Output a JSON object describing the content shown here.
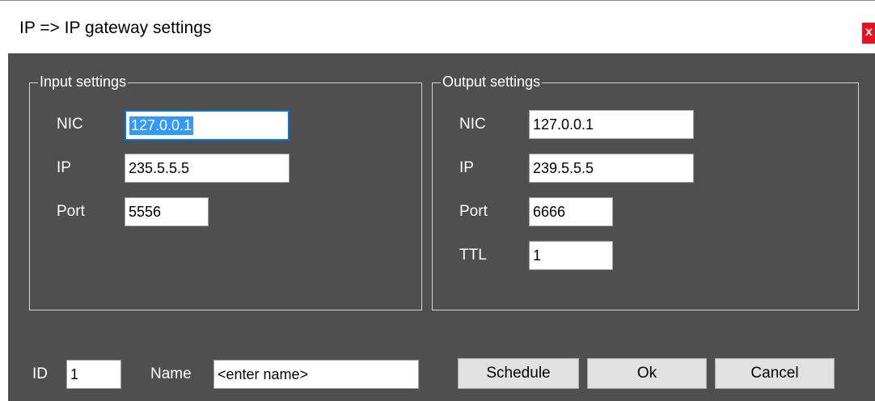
{
  "window": {
    "title": "IP => IP gateway settings",
    "close_label": "x"
  },
  "input_settings": {
    "legend": "Input settings",
    "nic_label": "NIC",
    "nic_value": "127.0.0.1",
    "ip_label": "IP",
    "ip_value": "235.5.5.5",
    "port_label": "Port",
    "port_value": "5556"
  },
  "output_settings": {
    "legend": "Output settings",
    "nic_label": "NIC",
    "nic_value": "127.0.0.1",
    "ip_label": "IP",
    "ip_value": "239.5.5.5",
    "port_label": "Port",
    "port_value": "6666",
    "ttl_label": "TTL",
    "ttl_value": "1"
  },
  "footer": {
    "id_label": "ID",
    "id_value": "1",
    "name_label": "Name",
    "name_value": "<enter name>",
    "schedule_label": "Schedule",
    "ok_label": "Ok",
    "cancel_label": "Cancel"
  },
  "colors": {
    "client_background": "#4f4f4f",
    "close_button": "#e81123",
    "focus_border": "#0078d7",
    "selection": "#3399ff"
  }
}
